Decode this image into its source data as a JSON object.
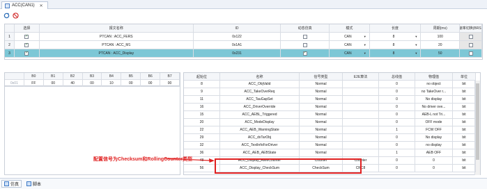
{
  "window": {
    "tab_title": "ACC(CAN1)",
    "close_symbol": "✕"
  },
  "toolbar": {
    "refresh_icon": "refresh-icon",
    "stop_icon": "stop-icon"
  },
  "top_table": {
    "headers": [
      "选择",
      "报文名称",
      "ID",
      "动态仿真",
      "模式",
      "长度",
      "周期(ms)",
      "速率切换(BRS)"
    ],
    "rows": [
      {
        "num": "1",
        "selected": true,
        "name": "PTCAN : ACC_FERS",
        "id": "0x122",
        "dynamic": false,
        "mode": "CAN",
        "length": "8",
        "period": "100",
        "brs": false,
        "highlight": false
      },
      {
        "num": "2",
        "selected": true,
        "name": "PTCAN : ACC_M1",
        "id": "0x1A1",
        "dynamic": false,
        "mode": "CAN",
        "length": "8",
        "period": "20",
        "brs": false,
        "highlight": false
      },
      {
        "num": "3",
        "selected": true,
        "name": "PTCAN : ACC_Display",
        "id": "0x231",
        "dynamic": true,
        "mode": "CAN",
        "length": "8",
        "period": "50",
        "brs": false,
        "highlight": true
      }
    ]
  },
  "hex_table": {
    "headers": [
      "B0",
      "B1",
      "B2",
      "B3",
      "B4",
      "B5",
      "B6",
      "B7"
    ],
    "row_label": "0x01",
    "values": [
      "FF",
      "00",
      "40",
      "00",
      "10",
      "00",
      "00",
      "00"
    ]
  },
  "signal_table": {
    "headers": [
      "起始位",
      "名称",
      "信号类型",
      "E2E算法",
      "总线值",
      "物理值",
      "单位"
    ],
    "rows": [
      [
        "8",
        "ACC_ObjValid",
        "Normal",
        "",
        "0",
        "no object",
        "bit"
      ],
      [
        "9",
        "ACC_TakeOverReq",
        "Normal",
        "",
        "0",
        "no TakeOver r...",
        "bit"
      ],
      [
        "11",
        "ACC_TauGapSet",
        "Normal",
        "",
        "0",
        "No display",
        "bit"
      ],
      [
        "16",
        "ACC_DriverOverride",
        "Normal",
        "",
        "0",
        "No driver ove...",
        "bit"
      ],
      [
        "15",
        "ACC_AEBL_Triggered",
        "Normal",
        "",
        "0",
        "AEB-L not Tri...",
        "bit"
      ],
      [
        "20",
        "ACC_ModeDisplay",
        "Normal",
        "",
        "0",
        "OFF mode",
        "bit"
      ],
      [
        "22",
        "ACC_AEB_WarningState",
        "Normal",
        "",
        "1",
        "FCW OFF",
        "bit"
      ],
      [
        "29",
        "ACC_dxTarObj",
        "Normal",
        "",
        "0",
        "No display",
        "bit"
      ],
      [
        "32",
        "ACC_TextInfoForDriver",
        "Normal",
        "",
        "0",
        "no display",
        "bit"
      ],
      [
        "36",
        "ACC_AEB_AEBState",
        "Normal",
        "",
        "1",
        "AEB OFF",
        "bit"
      ],
      [
        "48",
        "ACC_Display_AliveCounter",
        "Counter",
        "Counter",
        "0",
        "0",
        "bit"
      ],
      [
        "56",
        "ACC_Display_CheckSum",
        "CheckSum",
        "CRC8",
        "0",
        "0",
        "bit"
      ]
    ]
  },
  "annotation": {
    "text": "配置信号为Checksum和RollingCounter类型",
    "color": "#e02020"
  },
  "bottom_tabs": [
    {
      "label": "仿真",
      "active": true
    },
    {
      "label": "脚本",
      "active": false
    }
  ],
  "colors": {
    "selected_row": "#7dc7d6",
    "header_bg": "#f4f6f9"
  }
}
